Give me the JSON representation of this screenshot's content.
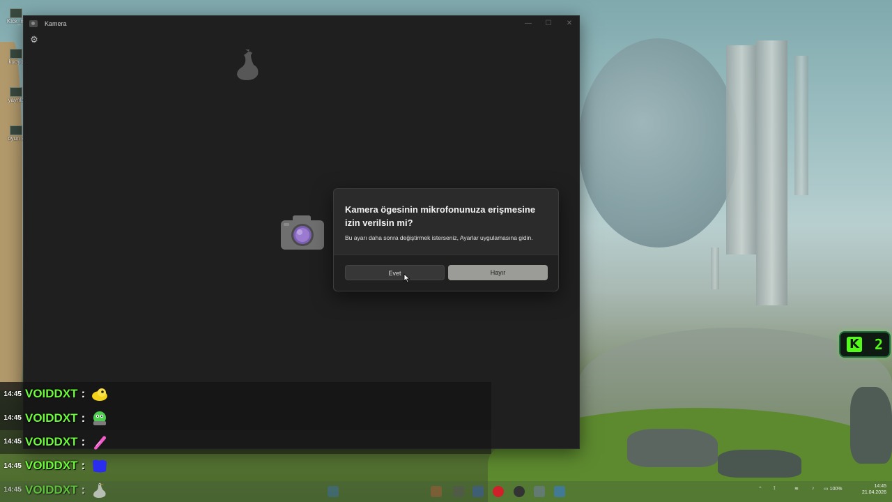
{
  "desktop": {
    "icons": [
      {
        "label": "Kick_m"
      },
      {
        "label": "kuoyo"
      },
      {
        "label": "yaynla"
      },
      {
        "label": "oyun s"
      }
    ]
  },
  "camera_window": {
    "title": "Kamera",
    "controls": {
      "minimize": "—",
      "maximize": "☐",
      "close": "✕"
    },
    "settings_icon": "gear-icon"
  },
  "dialog": {
    "title": "Kamera ögesinin mikrofonunuza erişmesine izin verilsin mi?",
    "body": "Bu ayarı daha sonra değiştirmek isterseniz, Ayarlar uygulamasına gidin.",
    "yes_label": "Evet",
    "no_label": "Hayır"
  },
  "kick_widget": {
    "logo": "K",
    "count": "2",
    "color": "#53fc18"
  },
  "chat": {
    "user_color": "#6dfa3a",
    "messages": [
      {
        "time": "14:45",
        "user": "VOIDDXT",
        "sep": ":",
        "emote": "yellow-blob-emote"
      },
      {
        "time": "14:45",
        "user": "VOIDDXT",
        "sep": ":",
        "emote": "green-face-emote"
      },
      {
        "time": "14:45",
        "user": "VOIDDXT",
        "sep": ":",
        "emote": "pink-tube-emote"
      },
      {
        "time": "14:45",
        "user": "VOIDDXT",
        "sep": ":",
        "emote": "blue-blob-emote"
      },
      {
        "time": "14:45",
        "user": "VOIDDXT",
        "sep": ":",
        "emote": "goose-emote"
      }
    ]
  },
  "taskbar": {
    "battery": "100%",
    "time": "14:45",
    "date": "21.04.2026"
  }
}
